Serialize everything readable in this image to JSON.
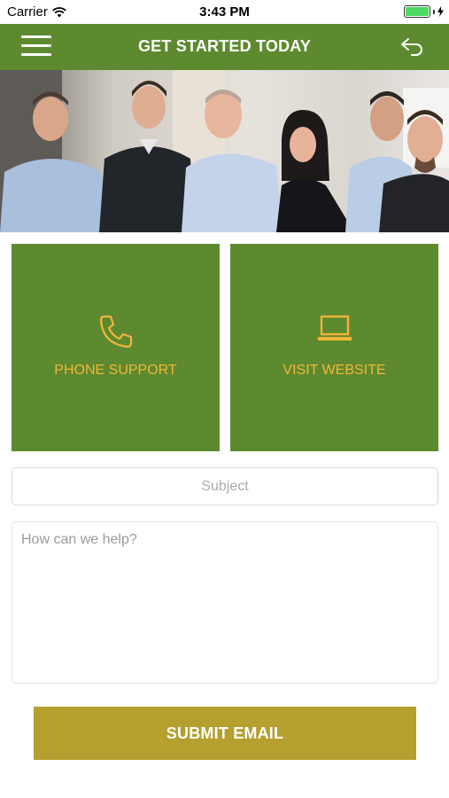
{
  "status_bar": {
    "carrier": "Carrier",
    "time": "3:43 PM",
    "wifi_icon": "wifi-icon",
    "battery_icon": "battery-icon",
    "charging_icon": "charging-bolt-icon",
    "battery_level": 1.0
  },
  "nav": {
    "title": "GET STARTED TODAY",
    "menu_icon": "hamburger-menu-icon",
    "back_icon": "back-arrow-icon"
  },
  "hero": {
    "description": "team-photo"
  },
  "tiles": {
    "phone_label": "PHONE SUPPORT",
    "phone_icon": "phone-icon",
    "website_label": "VISIT WEBSITE",
    "website_icon": "laptop-icon"
  },
  "form": {
    "subject_placeholder": "Subject",
    "message_placeholder": "How can we help?",
    "submit_label": "SUBMIT EMAIL"
  },
  "colors": {
    "primary_green": "#5d8a2f",
    "accent_orange": "#f3b43a",
    "submit_gold": "#b49f2f"
  }
}
